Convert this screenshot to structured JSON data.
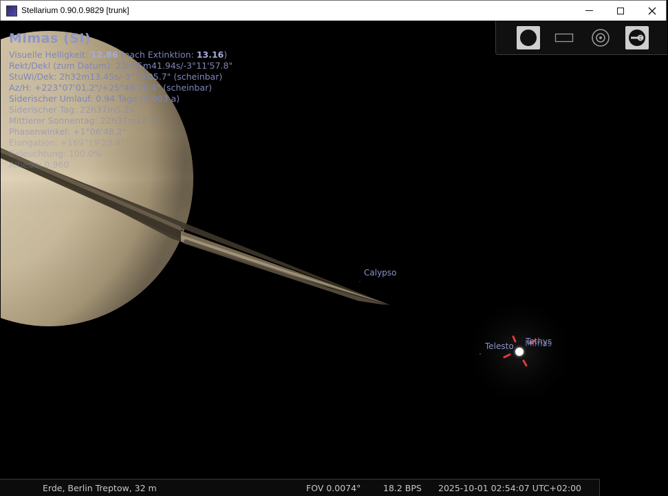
{
  "window": {
    "title": "Stellarium 0.90.0.9829 [trunk]",
    "minimize_glyph": "—",
    "maximize_glyph": "☐",
    "close_glyph": "✕"
  },
  "object_info": {
    "name": "Mimas (SI)",
    "magnitude_label": "Visuelle Helligkeit:",
    "magnitude_value": "12.86",
    "extinction_label": "(nach Extinktion:",
    "extinction_value": "13.16",
    "extinction_close": ")",
    "radec_date": "Rekt/Dekl (zum Datum): 23h55m41.94s/-3°11'57.8\"",
    "hadec": "StuWi/Dek: 2h32m13.45s/-3°10'05.7\" (scheinbar)",
    "azalt": "Az/H: +223°07'01.2\"/+25°46'29.4\" (scheinbar)",
    "sidereal_period": "Siderischer Umlauf: 0.94 Tage (0.003 a)",
    "sidereal_day": "Siderischer Tag: 22h37m5.2s",
    "solar_day": "Mittlerer Sonnentag: 22h37m12.4s",
    "phase_angle": "Phasenwinkel: +1°06'48.2\"",
    "elongation": "Elongation: +169°19'23.4\"",
    "illumination": "Beleuchtung: 100.0%",
    "albedo": "Albedo: 0.960"
  },
  "sky_labels": {
    "calypso": "Calypso",
    "telesto": "Telesto",
    "tethys": "Tethys",
    "mimas": "Mimas"
  },
  "toolbar": {
    "icons": [
      "night-mode-icon",
      "fullscreen-icon",
      "screen-overlay-icon",
      "quit-icon"
    ]
  },
  "status": {
    "location": "Erde, Berlin Treptow, 32 m",
    "fov": "FOV 0.0074°",
    "fps": "18.2 BPS",
    "datetime": "2025-10-01 02:54:07 UTC+02:00"
  },
  "colors": {
    "label": "#8b92c6",
    "pointer": "#e0393a",
    "sky": "#000000"
  }
}
